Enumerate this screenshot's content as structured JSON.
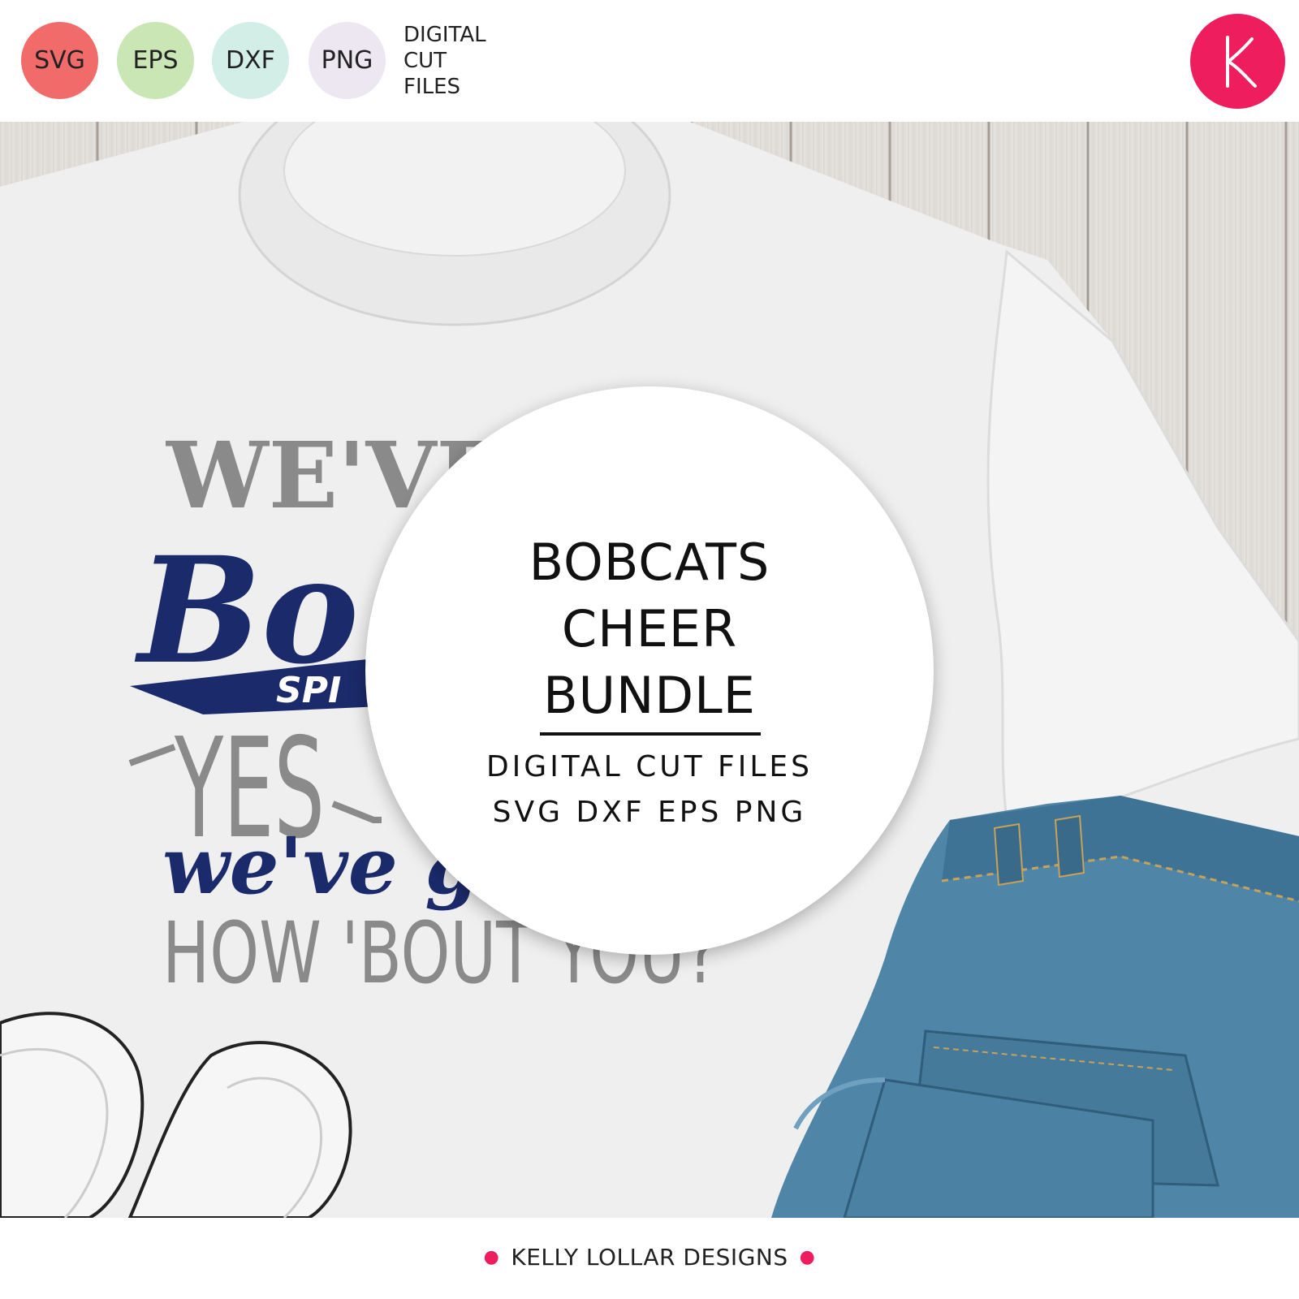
{
  "header": {
    "badges": [
      {
        "label": "SVG",
        "color": "#f26b6b"
      },
      {
        "label": "EPS",
        "color": "#c9e6b4"
      },
      {
        "label": "DXF",
        "color": "#d3ede7"
      },
      {
        "label": "PNG",
        "color": "#ece7f1"
      }
    ],
    "format_caption": "DIGITAL\nCUT\nFILES",
    "logo": {
      "letter": "K",
      "color": "#ee1d5e",
      "icon": "kelly-lollar-logo-icon"
    }
  },
  "shirt_design": {
    "line1": "WE'VE",
    "line2": "Bo",
    "banner": "SPI",
    "line3": "YES",
    "line4": "we've go",
    "line5": "HOW 'BOUT YOU?",
    "colors": {
      "gray": "#8a8a8a",
      "navy": "#1b2a6b"
    }
  },
  "title_card": {
    "title_lines": [
      "BOBCATS",
      "CHEER",
      "BUNDLE"
    ],
    "subtitle_lines": [
      "DIGITAL CUT FILES",
      "SVG DXF EPS PNG"
    ]
  },
  "footer": {
    "credit": "KELLY LOLLAR DESIGNS",
    "dot_color": "#ee1d5e"
  }
}
